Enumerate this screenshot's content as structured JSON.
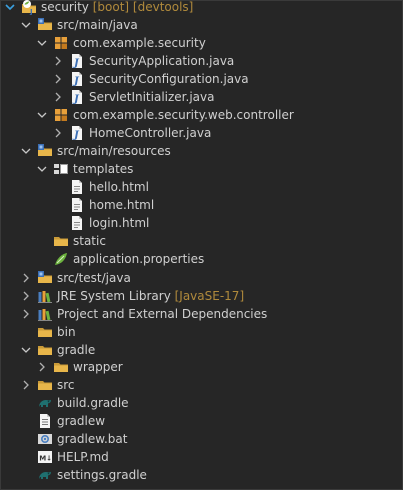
{
  "tree": [
    {
      "label": "security",
      "deco": "[boot] [devtools]",
      "icon": "spring-project-icon",
      "expanded": true
    },
    {
      "label": "src/main/java",
      "icon": "source-folder-icon",
      "expanded": true
    },
    {
      "label": "com.example.security",
      "icon": "package-icon",
      "expanded": true
    },
    {
      "label": "SecurityApplication.java",
      "icon": "java-file-icon",
      "expanded": false
    },
    {
      "label": "SecurityConfiguration.java",
      "icon": "java-file-icon",
      "expanded": false
    },
    {
      "label": "ServletInitializer.java",
      "icon": "java-file-icon",
      "expanded": false
    },
    {
      "label": "com.example.security.web.controller",
      "icon": "package-icon",
      "expanded": true
    },
    {
      "label": "HomeController.java",
      "icon": "java-file-icon",
      "expanded": false
    },
    {
      "label": "src/main/resources",
      "icon": "source-folder-icon",
      "expanded": true
    },
    {
      "label": "templates",
      "icon": "templates-folder-icon",
      "expanded": true
    },
    {
      "label": "hello.html",
      "icon": "html-file-icon"
    },
    {
      "label": "home.html",
      "icon": "html-file-icon"
    },
    {
      "label": "login.html",
      "icon": "html-file-icon"
    },
    {
      "label": "static",
      "icon": "folder-icon"
    },
    {
      "label": "application.properties",
      "icon": "properties-file-icon"
    },
    {
      "label": "src/test/java",
      "icon": "source-folder-icon",
      "expanded": false
    },
    {
      "label": "JRE System Library",
      "deco": "[JavaSE-17]",
      "icon": "library-icon",
      "expanded": false
    },
    {
      "label": "Project and External Dependencies",
      "icon": "library-icon",
      "expanded": false
    },
    {
      "label": "bin",
      "icon": "folder-icon"
    },
    {
      "label": "gradle",
      "icon": "folder-icon",
      "expanded": true
    },
    {
      "label": "wrapper",
      "icon": "folder-icon",
      "expanded": false
    },
    {
      "label": "src",
      "icon": "folder-icon",
      "expanded": false
    },
    {
      "label": "build.gradle",
      "icon": "gradle-file-icon"
    },
    {
      "label": "gradlew",
      "icon": "text-file-icon"
    },
    {
      "label": "gradlew.bat",
      "icon": "bat-file-icon"
    },
    {
      "label": "HELP.md",
      "icon": "markdown-file-icon"
    },
    {
      "label": "settings.gradle",
      "icon": "gradle-file-icon"
    }
  ],
  "colors": {
    "background": "#262626",
    "text": "#d0d0d0",
    "decoration": "#b08a3c",
    "folder": "#e8b64a",
    "package": "#e8a03a",
    "java_blue": "#4a7fc0",
    "spring_green": "#6db33f",
    "gradle_teal": "#1f6f6f"
  }
}
